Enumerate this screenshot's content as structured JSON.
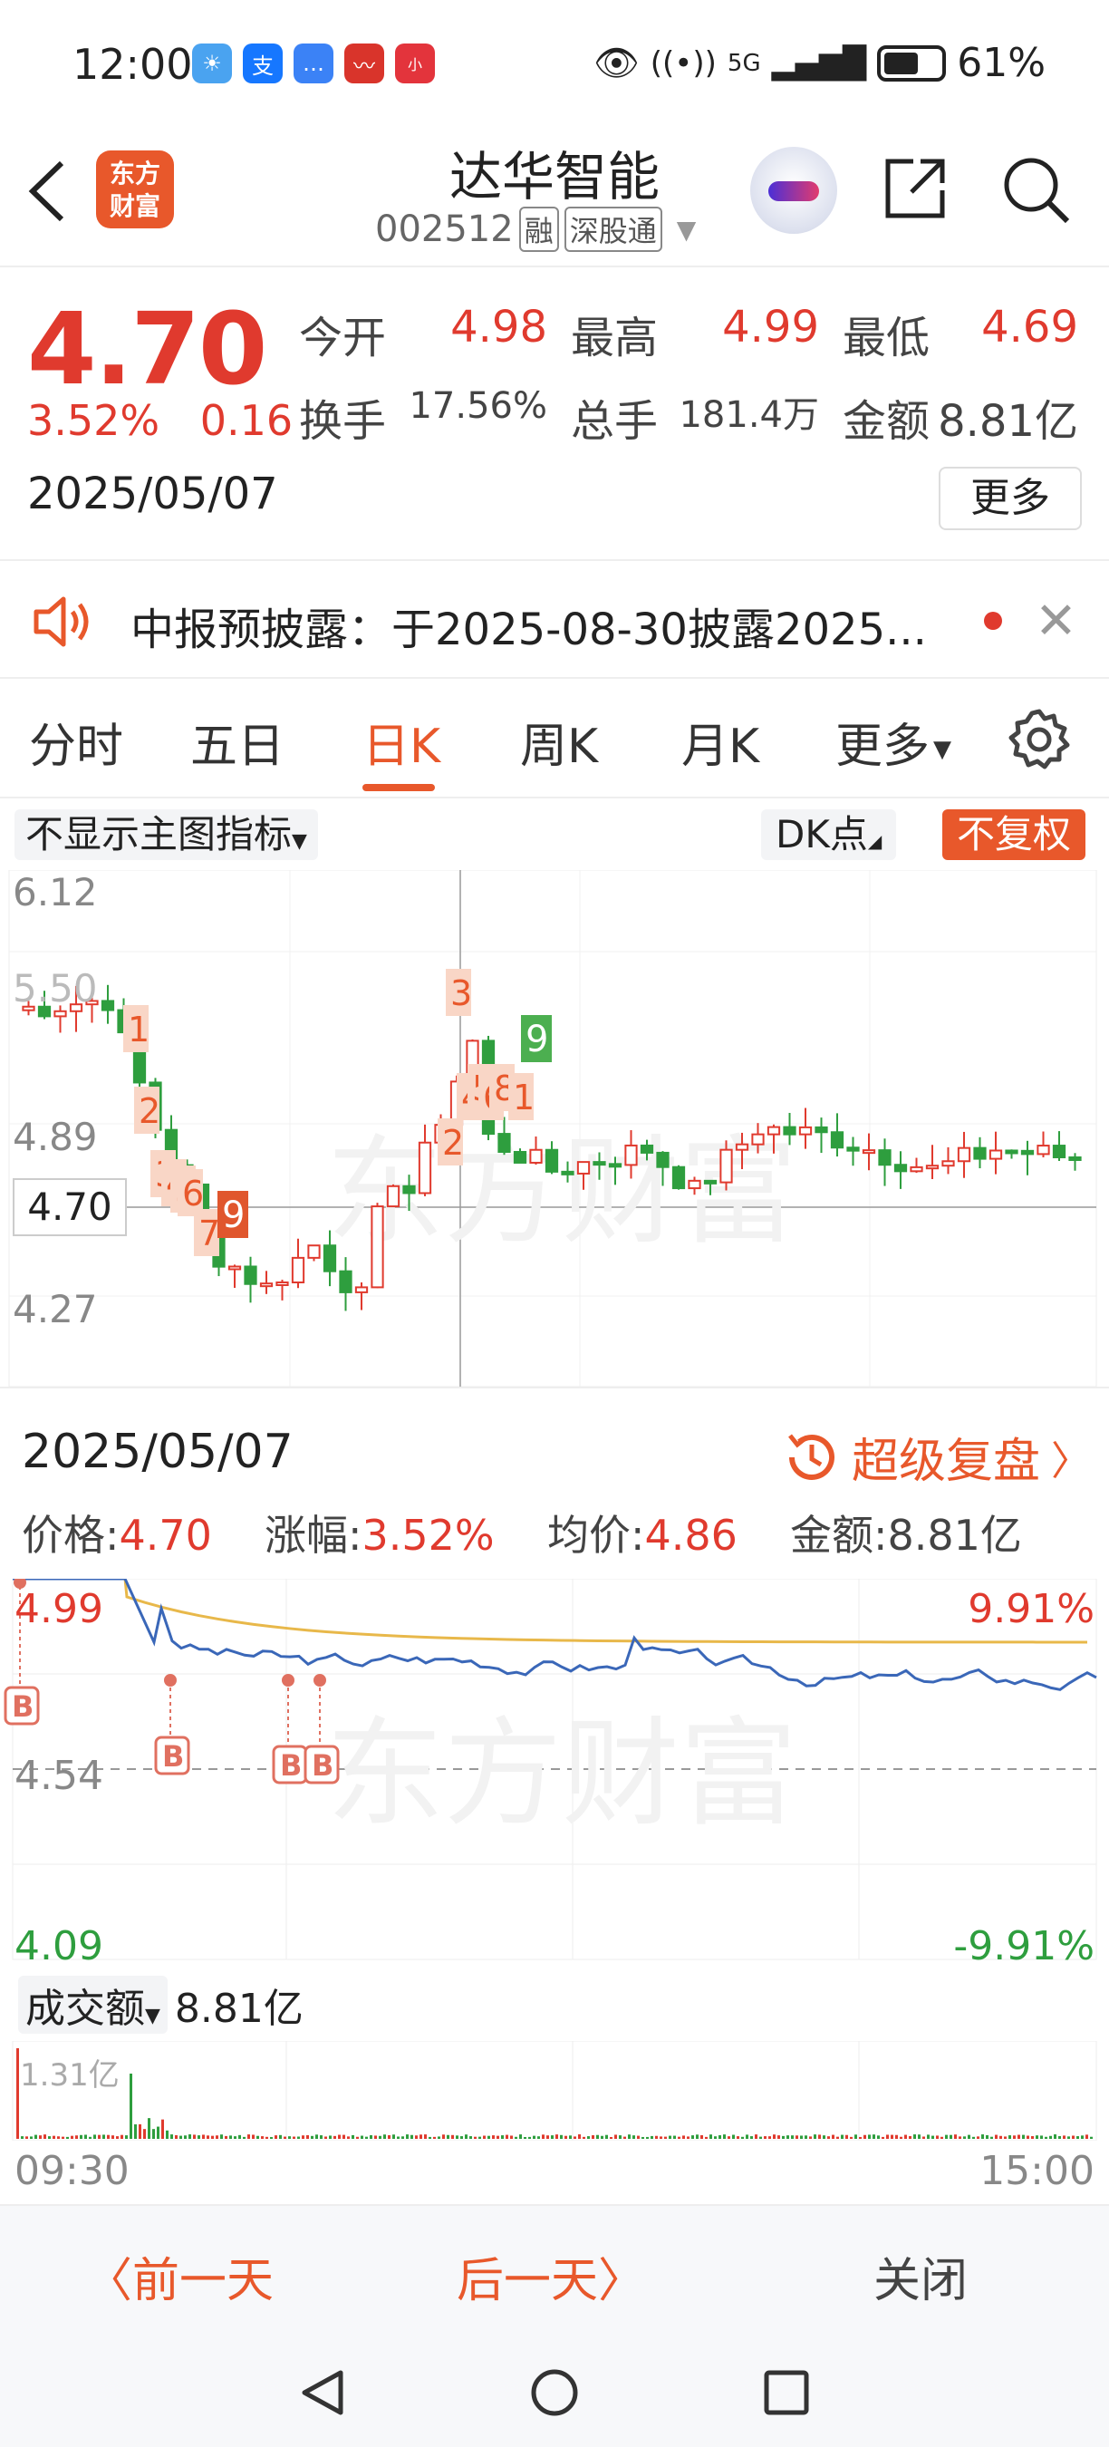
{
  "status_bar": {
    "time": "12:00",
    "signal": "5G",
    "battery": "61%",
    "battery_level": 0.61,
    "icons": [
      "weather-icon",
      "alipay-icon",
      "message-icon",
      "stock-app-icon",
      "red-app-icon"
    ]
  },
  "header": {
    "logo_line1": "东方",
    "logo_line2": "财富",
    "name": "达华智能",
    "code": "002512",
    "tag1": "融",
    "tag2": "深股通"
  },
  "quote": {
    "price": "4.70",
    "change_pct": "3.52%",
    "change_amt": "0.16",
    "date": "2025/05/07",
    "rows": [
      [
        {
          "label": "今开",
          "value": "4.98",
          "red": true
        },
        {
          "label": "最高",
          "value": "4.99",
          "red": true
        },
        {
          "label": "最低",
          "value": "4.69",
          "red": true
        }
      ],
      [
        {
          "label": "换手",
          "value": "17.56%",
          "red": false
        },
        {
          "label": "总手",
          "value": "181.4万",
          "red": false
        },
        {
          "label": "金额",
          "value": "8.81亿",
          "red": false
        }
      ]
    ],
    "more_label": "更多"
  },
  "notice": {
    "text": "中报预披露：于2025-08-30披露2025..."
  },
  "tabs": [
    "分时",
    "五日",
    "日K",
    "周K",
    "月K",
    "更多"
  ],
  "active_tab": "日K",
  "kline": {
    "indicator_btn": "不显示主图指标",
    "dk_btn": "DK点",
    "fq_btn": "不复权",
    "y_labels": [
      "6.12",
      "5.50",
      "4.89",
      "4.27"
    ],
    "current_price": "4.70",
    "watermark": "东方财富",
    "tags_red": [
      "1",
      "2",
      "3",
      "4",
      "5",
      "6",
      "7",
      "2",
      "3",
      "4",
      "5",
      "6",
      "8",
      "1"
    ],
    "tags_dark": [
      "9"
    ],
    "tags_green": [
      "9"
    ]
  },
  "panel": {
    "date": "2025/05/07",
    "replay_label": "超级复盘",
    "stats": [
      {
        "label": "价格:",
        "value": "4.70"
      },
      {
        "label": "涨幅:",
        "value": "3.52%"
      },
      {
        "label": "均价:",
        "value": "4.86"
      },
      {
        "label": "金额:",
        "value": "8.81亿"
      }
    ],
    "y_high": "4.99",
    "y_mid": "4.54",
    "y_low": "4.09",
    "pct_high": "9.91%",
    "pct_low": "-9.91%",
    "marker": "B",
    "volume_label": "成交额",
    "volume_value": "8.81亿",
    "volume_max": "1.31亿",
    "time_start": "09:30",
    "time_end": "15:00"
  },
  "nav": {
    "prev": "前一天",
    "next": "后一天",
    "close": "关闭"
  },
  "colors": {
    "up": "#e03a2e",
    "down": "#2e9e3e",
    "accent": "#e8582b",
    "price_line": "#3a67b8",
    "avg_line": "#e8b84a"
  }
}
